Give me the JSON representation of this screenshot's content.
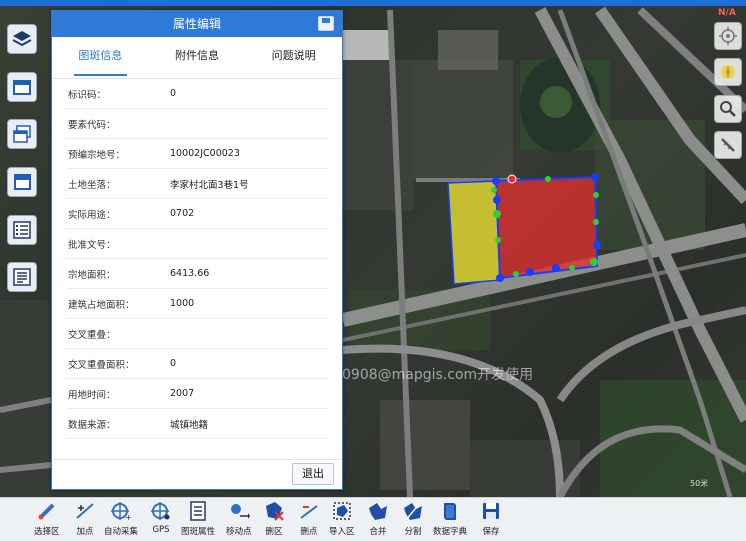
{
  "dialog": {
    "title": "属性编辑",
    "tabs": [
      {
        "label": "图斑信息",
        "active": true
      },
      {
        "label": "附件信息",
        "active": false
      },
      {
        "label": "问题说明",
        "active": false
      }
    ],
    "fields": [
      {
        "key": "标识码：",
        "value": "0"
      },
      {
        "key": "要素代码：",
        "value": ""
      },
      {
        "key": "预编宗地号：",
        "value": "10002JC00023"
      },
      {
        "key": "土地坐落：",
        "value": "李家村北面3巷1号"
      },
      {
        "key": "实际用途：",
        "value": "0702"
      },
      {
        "key": "批准文号：",
        "value": ""
      },
      {
        "key": "宗地面积：",
        "value": "6413.66"
      },
      {
        "key": "建筑占地面积：",
        "value": "1000"
      },
      {
        "key": "交叉重叠：",
        "value": ""
      },
      {
        "key": "交叉重叠面积：",
        "value": "0"
      },
      {
        "key": "用地时间：",
        "value": "2007"
      },
      {
        "key": "数据来源：",
        "value": "城镇地籍"
      }
    ],
    "exit_label": "退出"
  },
  "map": {
    "watermark": "0908@mapgis.com开发使用",
    "scale_label": "50米",
    "corner_label": "N/A"
  },
  "left_toolbar": [
    "layers-icon",
    "window-icon",
    "windows-icon",
    "window-stack-icon",
    "checklist-icon",
    "list-icon"
  ],
  "right_toolbar": [
    "locate-icon",
    "compass-icon",
    "magnifier-icon",
    "measure-icon"
  ],
  "bottom_toolbar": [
    {
      "label": "选择区",
      "icon": "select-area-icon"
    },
    {
      "label": "加点",
      "icon": "add-point-icon"
    },
    {
      "label": "自动采集",
      "icon": "auto-collect-icon"
    },
    {
      "label": "GPS",
      "icon": "gps-icon"
    },
    {
      "label": "图斑属性",
      "icon": "attribute-icon"
    },
    {
      "label": "移动点",
      "icon": "move-point-icon"
    },
    {
      "label": "删区",
      "icon": "delete-area-icon"
    },
    {
      "label": "删点",
      "icon": "delete-point-icon"
    },
    {
      "label": "导入区",
      "icon": "import-area-icon"
    },
    {
      "label": "合并",
      "icon": "merge-icon"
    },
    {
      "label": "分割",
      "icon": "split-icon"
    },
    {
      "label": "数据字典",
      "icon": "dictionary-icon"
    },
    {
      "label": "保存",
      "icon": "save-icon"
    }
  ],
  "colors": {
    "accent": "#2f7ad6",
    "polygon_red": "#e03030",
    "polygon_yellow": "#e8e030",
    "vertex_blue": "#1a3cff",
    "vertex_green": "#2fd02f"
  }
}
